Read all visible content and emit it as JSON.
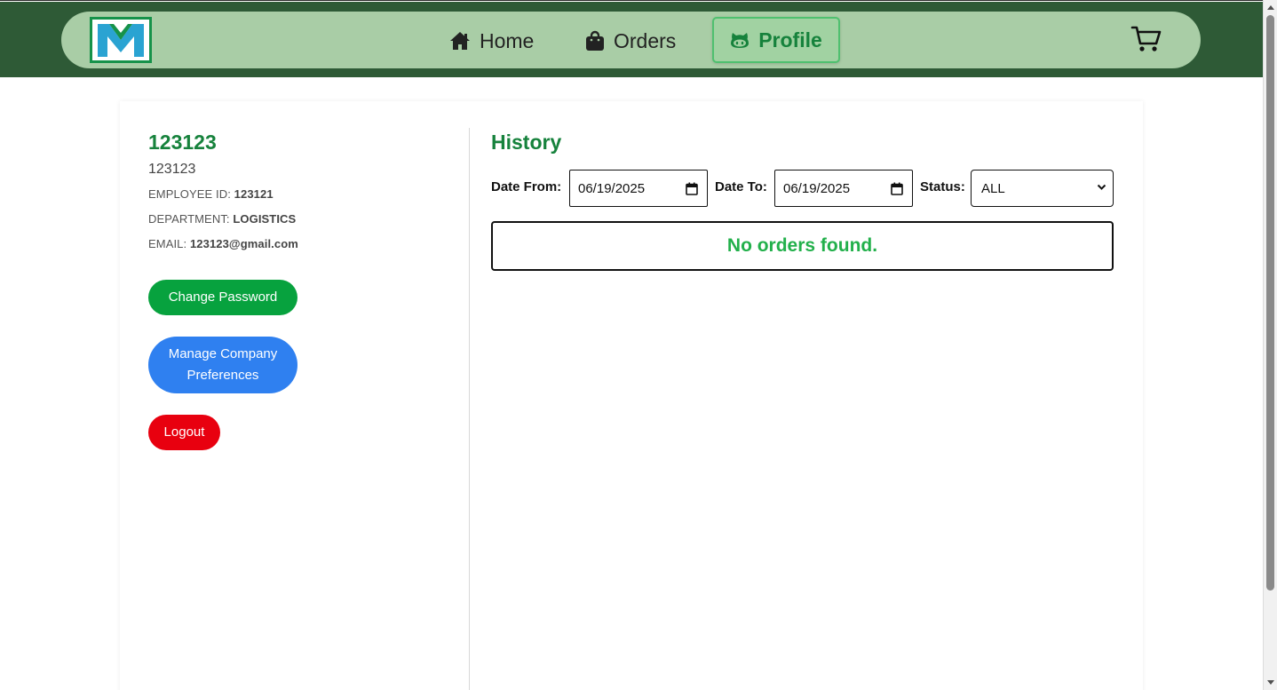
{
  "nav": {
    "logo_icon": "m-logo-icon",
    "home": "Home",
    "orders": "Orders",
    "profile": "Profile",
    "home_icon": "house-icon",
    "orders_icon": "shopping-bag-icon",
    "profile_icon": "github-cat-icon",
    "cart_icon": "shopping-cart-icon"
  },
  "profile": {
    "name": "123123",
    "subtitle": "123123",
    "employee_id_label": "EMPLOYEE ID:",
    "employee_id": "123121",
    "department_label": "DEPARTMENT:",
    "department": "LOGISTICS",
    "email_label": "EMAIL:",
    "email": "123123@gmail.com"
  },
  "actions": {
    "change_password": "Change Password",
    "manage_prefs_line1": "Manage Company",
    "manage_prefs_line2": "Preferences",
    "logout": "Logout"
  },
  "history": {
    "title": "History",
    "date_from_label": "Date From:",
    "date_from": "06/19/2025",
    "date_to_label": "Date To:",
    "date_to": "06/19/2025",
    "status_label": "Status:",
    "status_value": "ALL",
    "empty_message": "No orders found."
  },
  "colors": {
    "topbar": "#2e5a36",
    "nav_pill": "#a9cda6",
    "accent_green": "#16823c",
    "button_green": "#07a23e",
    "button_blue": "#2f80f0",
    "button_red": "#e8000f",
    "empty_text": "#22b04b"
  }
}
